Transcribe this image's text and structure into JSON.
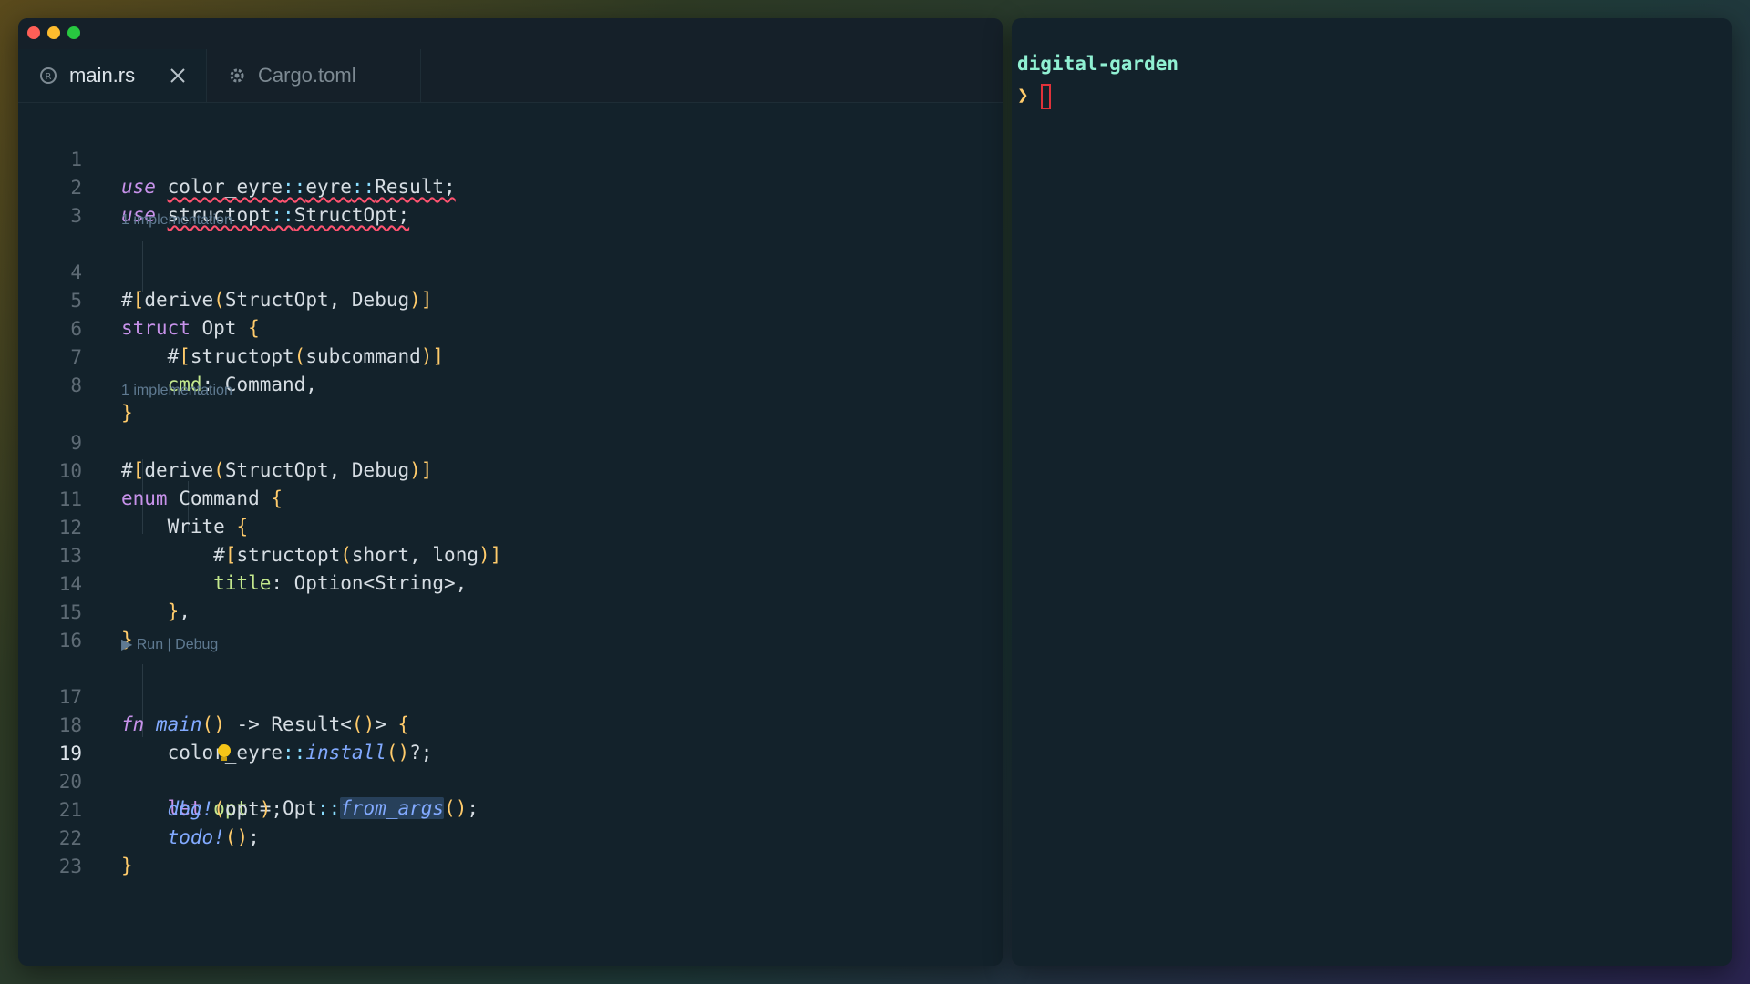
{
  "editor": {
    "tabs": [
      {
        "label": "main.rs",
        "icon": "rust-icon",
        "active": true
      },
      {
        "label": "Cargo.toml",
        "icon": "gear-icon",
        "active": false
      }
    ],
    "current_line": "19",
    "lenses": {
      "impl1": "1 implementation",
      "impl2": "1 implementation",
      "run_debug": "▶ Run | Debug"
    },
    "lines": [
      {
        "num": "1",
        "code": "use color_eyre::eyre::Result;"
      },
      {
        "num": "2",
        "code": "use structopt::StructOpt;"
      },
      {
        "num": "3",
        "code": ""
      },
      {
        "num": "4",
        "code": "#[derive(StructOpt, Debug)]"
      },
      {
        "num": "5",
        "code": "struct Opt {"
      },
      {
        "num": "6",
        "code": "    #[structopt(subcommand)]"
      },
      {
        "num": "7",
        "code": "    cmd: Command,"
      },
      {
        "num": "8",
        "code": "}"
      },
      {
        "num": "9",
        "code": "#[derive(StructOpt, Debug)]"
      },
      {
        "num": "10",
        "code": "enum Command {"
      },
      {
        "num": "11",
        "code": "    Write {"
      },
      {
        "num": "12",
        "code": "        #[structopt(short, long)]"
      },
      {
        "num": "13",
        "code": "        title: Option<String>,"
      },
      {
        "num": "14",
        "code": "    },"
      },
      {
        "num": "15",
        "code": "}"
      },
      {
        "num": "16",
        "code": ""
      },
      {
        "num": "17",
        "code": "fn main() -> Result<()> {"
      },
      {
        "num": "18",
        "code": "    color_eyre::install()?;"
      },
      {
        "num": "19",
        "code": "    let opt = Opt::from_args();"
      },
      {
        "num": "20",
        "code": "    dbg!(opt);"
      },
      {
        "num": "21",
        "code": "    todo!();"
      },
      {
        "num": "22",
        "code": "}"
      },
      {
        "num": "23",
        "code": ""
      }
    ]
  },
  "terminal": {
    "title": "digital-garden",
    "prompt_symbol": "❯"
  },
  "colors": {
    "keyword": "#c792ea",
    "bracket": "#ffcb6b",
    "punct": "#89ddff",
    "field": "#c3e88d",
    "function": "#82aaff",
    "error_squiggle": "#ff5370",
    "terminal_title": "#90f0d2"
  }
}
